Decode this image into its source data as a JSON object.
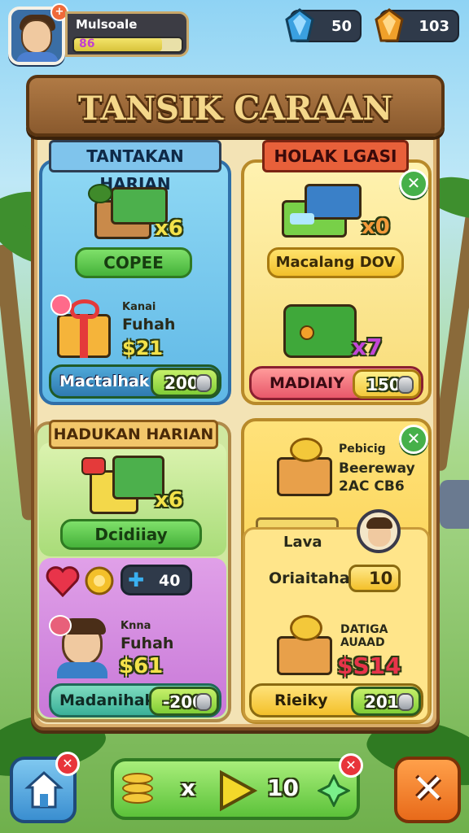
{
  "player": {
    "name": "Mulsoale",
    "xp_text": "86",
    "xp_fill": 0.82,
    "notification": "+"
  },
  "currencies": [
    {
      "name": "gems",
      "value": "50",
      "color": "#3aa0e0"
    },
    {
      "name": "gold",
      "value": "103",
      "color": "#f0a02a"
    }
  ],
  "title": "TANSIK CARAAN",
  "panels": {
    "daily_tasks": {
      "ribbon": "TANTAKAN HARIAN",
      "reward_count": "x6",
      "claim_button": "COPEE",
      "gift_title": "Kanai",
      "gift_subtitle": "Fuhah",
      "gift_price": "$21",
      "buy_label": "Mactalhak",
      "buy_price": "200"
    },
    "location": {
      "ribbon": "HOLAK LGASI",
      "reward_count": "x0",
      "claim_button": "Macalang DOV",
      "reward2_count": "x7",
      "buy_label": "MADIAIY",
      "buy_price": "150"
    },
    "daily_missions": {
      "ribbon": "HADUKAN HARIAN",
      "reward_count": "x6",
      "claim_button": "Dcidiiay",
      "gem_count": "40",
      "gift_title": "Knna",
      "gift_subtitle": "Fuhah",
      "gift_price": "$61",
      "buy_label": "Madanihak",
      "buy_price": "-200"
    },
    "offers": {
      "offer1_line1": "Pebicig",
      "offer1_line2": "Beereway",
      "offer1_line3": "2AC CB6",
      "tab_label": "Lava",
      "oriaitahas_label": "Oriaitahas",
      "oriaitahas_value": "10",
      "offer2_line1": "DATIGA",
      "offer2_line2": "AUAAD",
      "offer2_price": "$S14",
      "buy_label": "Rieiky",
      "buy_price": "201"
    }
  },
  "bottom_bar": {
    "multiplier_x": "x",
    "count": "10"
  }
}
